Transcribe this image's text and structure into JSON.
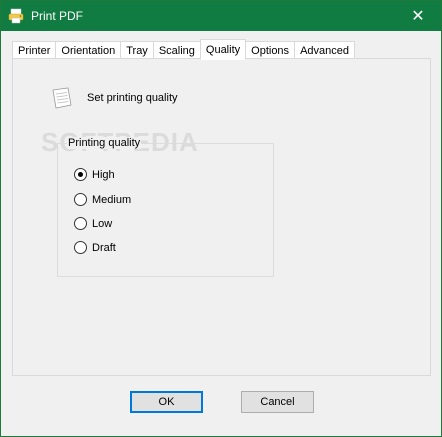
{
  "window": {
    "title": "Print PDF",
    "close_symbol": "✕"
  },
  "tabs": [
    {
      "label": "Printer",
      "active": false
    },
    {
      "label": "Orientation",
      "active": false
    },
    {
      "label": "Tray",
      "active": false
    },
    {
      "label": "Scaling",
      "active": false
    },
    {
      "label": "Quality",
      "active": true
    },
    {
      "label": "Options",
      "active": false
    },
    {
      "label": "Advanced",
      "active": false
    }
  ],
  "panel": {
    "header_label": "Set printing quality",
    "watermark": "SOFTPEDIA",
    "group": {
      "label": "Printing quality",
      "options": [
        {
          "label": "High",
          "checked": true
        },
        {
          "label": "Medium",
          "checked": false
        },
        {
          "label": "Low",
          "checked": false
        },
        {
          "label": "Draft",
          "checked": false
        }
      ]
    }
  },
  "buttons": {
    "ok": "OK",
    "cancel": "Cancel"
  },
  "colors": {
    "titlebar": "#107c41",
    "default_button_border": "#0078d7"
  },
  "icons": {
    "app": "printer-app-icon",
    "header": "document-settings-icon",
    "close": "close-icon"
  }
}
